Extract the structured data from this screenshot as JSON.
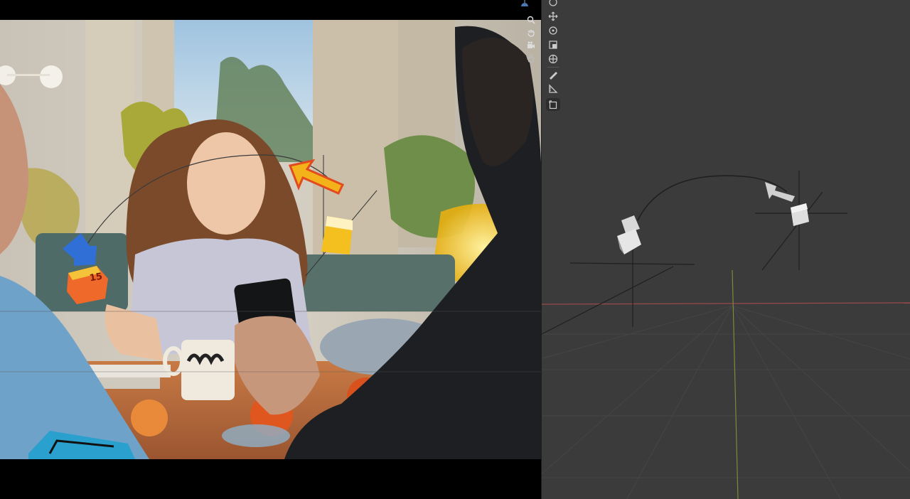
{
  "app": {
    "panels": [
      "camera-view",
      "viewport-3d"
    ]
  },
  "colors": {
    "viewport_bg": "#3b3b3b",
    "grid_line": "#464646",
    "x_axis": "#9a4a4a",
    "y_axis": "#7d8a3a",
    "camera_arrow_yellow": "#f3b21a",
    "camera_arrow_red": "#e24a1f",
    "camera_blue": "#2f6fd6",
    "camera_orange": "#ef6a2a"
  },
  "tools": [
    {
      "name": "cursor-icon"
    },
    {
      "name": "move-icon"
    },
    {
      "name": "rotate-icon"
    },
    {
      "name": "scale-icon"
    },
    {
      "name": "transform-icon"
    },
    {
      "name": "annotate-icon"
    },
    {
      "name": "measure-icon"
    },
    {
      "name": "add-cube-icon"
    }
  ],
  "nav": [
    {
      "name": "zoom-icon"
    },
    {
      "name": "pan-hand-icon"
    },
    {
      "name": "camera-icon"
    },
    {
      "name": "lock-icon"
    }
  ],
  "overlay_label": {
    "badge_number": "15"
  }
}
